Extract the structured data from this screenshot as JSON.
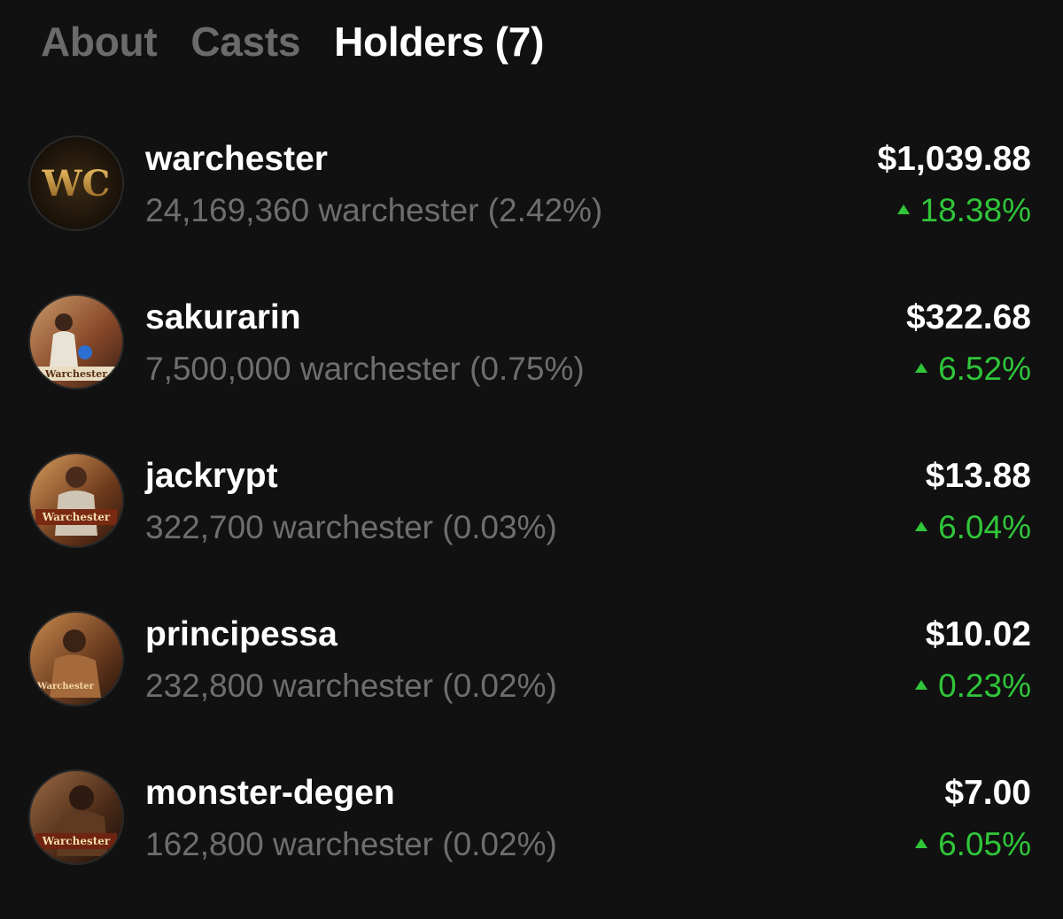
{
  "tabs": [
    {
      "label": "About",
      "active": false
    },
    {
      "label": "Casts",
      "active": false
    },
    {
      "label": "Holders (7)",
      "active": true
    }
  ],
  "colors": {
    "background": "#111111",
    "tab_inactive": "#6b6b6b",
    "secondary_text": "#6e6e6e",
    "positive": "#30c63a"
  },
  "holders": [
    {
      "name": "warchester",
      "amount": "24,169,360 warchester (2.42%)",
      "value": "$1,039.88",
      "change": "18.38%",
      "change_icon": "triangle-up-icon",
      "avatar_text": "WC"
    },
    {
      "name": "sakurarin",
      "amount": "7,500,000 warchester (0.75%)",
      "value": "$322.68",
      "change": "6.52%",
      "change_icon": "triangle-up-icon",
      "avatar_text": "Warchester"
    },
    {
      "name": "jackrypt",
      "amount": "322,700 warchester (0.03%)",
      "value": "$13.88",
      "change": "6.04%",
      "change_icon": "triangle-up-icon",
      "avatar_text": "Warchester"
    },
    {
      "name": "principessa",
      "amount": "232,800 warchester (0.02%)",
      "value": "$10.02",
      "change": "0.23%",
      "change_icon": "triangle-up-icon",
      "avatar_text": "Warchester"
    },
    {
      "name": "monster-degen",
      "amount": "162,800 warchester (0.02%)",
      "value": "$7.00",
      "change": "6.05%",
      "change_icon": "triangle-up-icon",
      "avatar_text": "Warchester"
    }
  ]
}
